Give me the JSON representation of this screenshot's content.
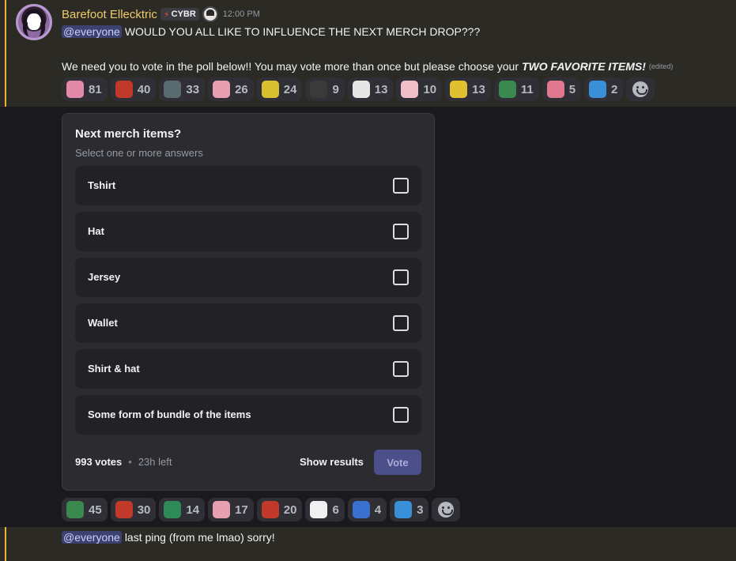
{
  "message": {
    "author": "Barefoot Ellecktric",
    "tag": "CYBR",
    "timestamp": "12:00 PM",
    "mention": "@everyone",
    "line1": "WOULD YOU ALL LIKE TO INFLUENCE THE NEXT MERCH DROP???",
    "line2": "We need you to vote in the poll below!! You may vote more than once but please choose your",
    "line2_emphasis": "TWO FAVORITE ITEMS!",
    "edited": "(edited)"
  },
  "reactions_top": [
    {
      "count": "81",
      "icon": "pink-creature-emoji",
      "color": "#e38aa8"
    },
    {
      "count": "40",
      "icon": "red-dragon-emoji",
      "color": "#c0392b"
    },
    {
      "count": "33",
      "icon": "robot-spider-emoji",
      "color": "#5a6b6f"
    },
    {
      "count": "26",
      "icon": "pink-pig-emoji",
      "color": "#e8a0b0"
    },
    {
      "count": "24",
      "icon": "yellow-bird-emoji",
      "color": "#d8c030"
    },
    {
      "count": "9",
      "icon": "black-car-emoji",
      "color": "#3a3a3a"
    },
    {
      "count": "13",
      "icon": "white-meme-face-emoji",
      "color": "#e6e6e6"
    },
    {
      "count": "10",
      "icon": "pink-cat-emoji",
      "color": "#f0c0c8"
    },
    {
      "count": "13",
      "icon": "yellow-eyes-emoji",
      "color": "#e0c030"
    },
    {
      "count": "11",
      "icon": "green-frog-emoji",
      "color": "#3a8a50"
    },
    {
      "count": "5",
      "icon": "pink-pig-small-emoji",
      "color": "#e07890"
    },
    {
      "count": "2",
      "icon": "blue-fish-emoji",
      "color": "#3a90d8"
    }
  ],
  "poll": {
    "question": "Next merch items?",
    "subtitle": "Select one or more answers",
    "options": [
      "Tshirt",
      "Hat",
      "Jersey",
      "Wallet",
      "Shirt & hat",
      "Some form of bundle of the items"
    ],
    "votes": "993 votes",
    "time_left": "23h left",
    "show_results": "Show results",
    "vote": "Vote"
  },
  "reactions_bottom": [
    {
      "count": "45",
      "icon": "green-frog-emoji",
      "color": "#3a8a50"
    },
    {
      "count": "30",
      "icon": "red-dragon-emoji",
      "color": "#c0392b"
    },
    {
      "count": "14",
      "icon": "green-hat-emoji",
      "color": "#2e8b57"
    },
    {
      "count": "17",
      "icon": "pink-pig-emoji",
      "color": "#e8a0b0"
    },
    {
      "count": "20",
      "icon": "red-dragon-emoji",
      "color": "#c0392b"
    },
    {
      "count": "6",
      "icon": "mega-milk-emoji",
      "color": "#f0f0f0"
    },
    {
      "count": "4",
      "icon": "blue-underwear-emoji",
      "color": "#3a70d0"
    },
    {
      "count": "3",
      "icon": "blue-fish-emoji",
      "color": "#3a90d8"
    }
  ],
  "message2": {
    "mention": "@everyone",
    "text": "last ping (from me lmao) sorry!"
  }
}
